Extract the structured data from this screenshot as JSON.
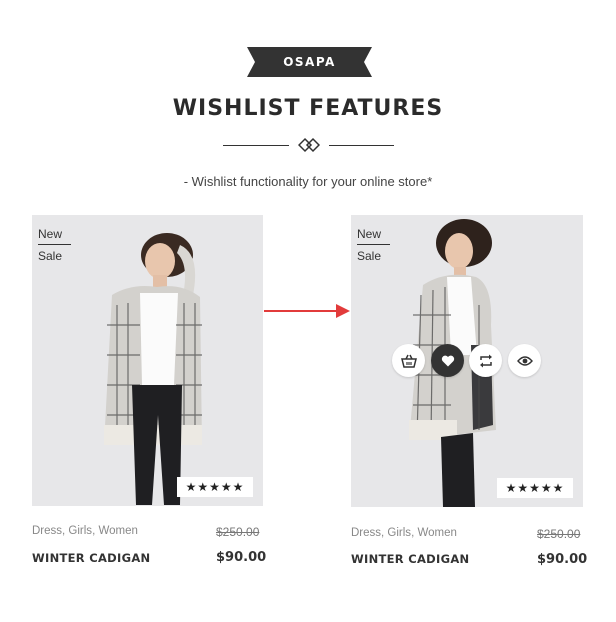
{
  "banner": {
    "brand": "OSAPA"
  },
  "header": {
    "title": "WISHLIST FEATURES",
    "subtitle": "- Wishlist functionality for your online store*"
  },
  "colors": {
    "accent": "#333333",
    "arrow": "#e23b3b",
    "photo_bg": "#e7e7e9"
  },
  "products": [
    {
      "badge_new": "New",
      "badge_sale": "Sale",
      "rating": "★★★★★",
      "categories": [
        "Dress",
        "Girls",
        "Women"
      ],
      "old_price": "$250.00",
      "name": "WINTER CADIGAN",
      "price": "$90.00"
    },
    {
      "badge_new": "New",
      "badge_sale": "Sale",
      "rating": "★★★★★",
      "categories": [
        "Dress",
        "Girls",
        "Women"
      ],
      "old_price": "$250.00",
      "name": "WINTER CADIGAN",
      "price": "$90.00",
      "actions": [
        "basket-icon",
        "heart-icon",
        "compare-icon",
        "eye-icon"
      ]
    }
  ]
}
